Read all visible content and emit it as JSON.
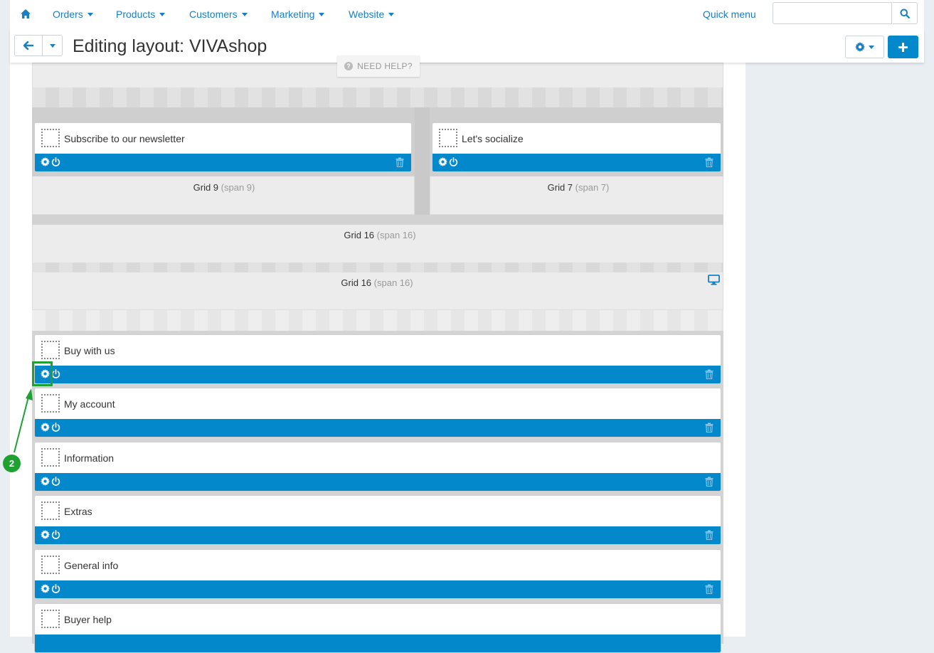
{
  "nav": {
    "items": [
      {
        "label": "Orders"
      },
      {
        "label": "Products"
      },
      {
        "label": "Customers"
      },
      {
        "label": "Marketing"
      },
      {
        "label": "Website"
      }
    ],
    "quick_menu": "Quick menu",
    "search_value": ""
  },
  "header": {
    "title": "Editing layout: VIVAshop",
    "need_help": "NEED HELP?"
  },
  "grids": {
    "g9": {
      "name": "Grid 9",
      "span": "(span 9)"
    },
    "g7": {
      "name": "Grid 7",
      "span": "(span 7)"
    },
    "g16a": {
      "name": "Grid 16",
      "span": "(span 16)"
    },
    "g16b": {
      "name": "Grid 16",
      "span": "(span 16)"
    }
  },
  "blocks": {
    "newsletter": "Subscribe to our newsletter",
    "socialize": "Let's socialize",
    "buy_with_us": "Buy with us",
    "my_account": "My account",
    "information": "Information",
    "extras": "Extras",
    "general_info": "General info",
    "buyer_help": "Buyer help"
  },
  "callout": {
    "step": "2"
  },
  "colors": {
    "accent": "#0388cc",
    "link": "#1a7ec2",
    "callout": "#1fa031"
  }
}
